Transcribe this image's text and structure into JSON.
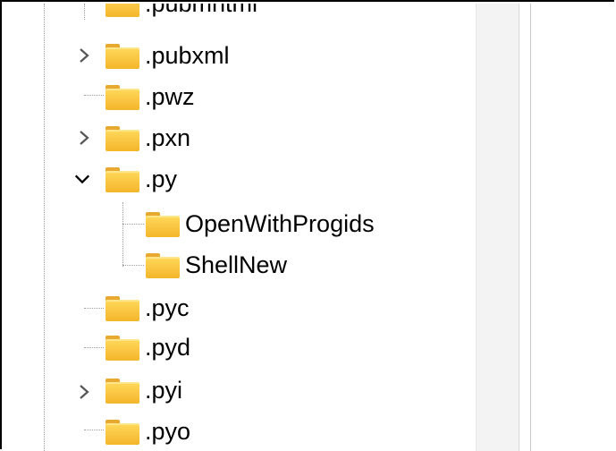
{
  "tree": {
    "items": [
      {
        "label": ".pubmhtml",
        "expander": "none"
      },
      {
        "label": ".pubxml",
        "expander": "collapsed"
      },
      {
        "label": ".pwz",
        "expander": "none"
      },
      {
        "label": ".pxn",
        "expander": "collapsed"
      },
      {
        "label": ".py",
        "expander": "expanded"
      },
      {
        "label": "OpenWithProgids",
        "expander": "none"
      },
      {
        "label": "ShellNew",
        "expander": "none"
      },
      {
        "label": ".pyc",
        "expander": "none"
      },
      {
        "label": ".pyd",
        "expander": "none"
      },
      {
        "label": ".pyi",
        "expander": "collapsed"
      },
      {
        "label": ".pyo",
        "expander": "none"
      }
    ]
  },
  "icons": {
    "folder": "folder-icon",
    "collapsed": "chevron-right-icon",
    "expanded": "chevron-down-icon"
  },
  "colors": {
    "folder_body": "#f4b52a",
    "folder_tab": "#e8a930",
    "scrollbar_track": "#f3f3f3"
  }
}
